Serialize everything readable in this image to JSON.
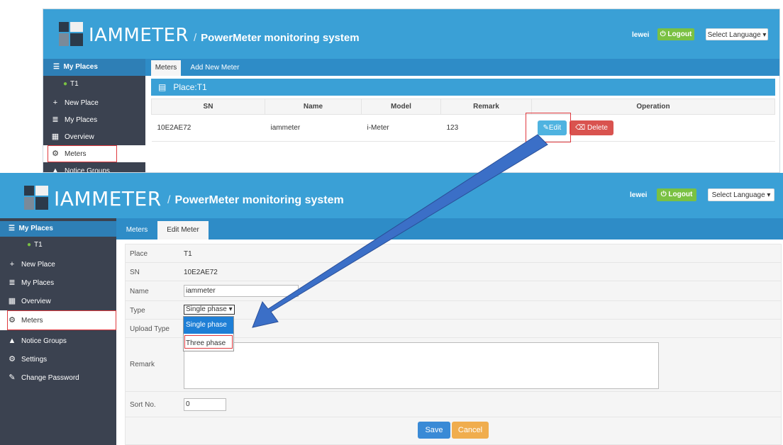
{
  "top_screen": {
    "brand": "IAMMETER",
    "subtitle": "PowerMeter monitoring system",
    "username": "lewei",
    "logout_label": "⏻ Logout",
    "language_label": "Select Language ▾",
    "sidebar": {
      "header": "My Places",
      "place": "T1",
      "items": [
        {
          "icon": "+",
          "label": "New Place"
        },
        {
          "icon": "≣",
          "label": "My Places"
        },
        {
          "icon": "▦",
          "label": "Overview"
        },
        {
          "icon": "⚙",
          "label": "Meters"
        },
        {
          "icon": "▲",
          "label": "Notice Groups"
        }
      ]
    },
    "tabs": [
      "Meters",
      "Add New Meter"
    ],
    "place_title": "Place:T1",
    "table": {
      "headers": [
        "SN",
        "Name",
        "Model",
        "Remark",
        "Operation"
      ],
      "rows": [
        {
          "sn": "10E2AE72",
          "name": "iammeter",
          "model": "i-Meter",
          "remark": "123",
          "edit": "✎Edit",
          "delete": "⌫ Delete"
        }
      ]
    }
  },
  "bottom_screen": {
    "brand": "IAMMETER",
    "subtitle": "PowerMeter monitoring system",
    "username": "lewei",
    "logout_label": "⏻ Logout",
    "language_label": "Select Language ▾",
    "sidebar": {
      "header": "My Places",
      "place": "T1",
      "items": [
        {
          "icon": "+",
          "label": "New Place"
        },
        {
          "icon": "≣",
          "label": "My Places"
        },
        {
          "icon": "▦",
          "label": "Overview"
        },
        {
          "icon": "⚙",
          "label": "Meters"
        },
        {
          "icon": "▲",
          "label": "Notice Groups"
        },
        {
          "icon": "⚙",
          "label": "Settings"
        },
        {
          "icon": "✎",
          "label": "Change Password"
        }
      ]
    },
    "tabs": [
      "Meters",
      "Edit Meter"
    ],
    "form": {
      "place_label": "Place",
      "place_value": "T1",
      "sn_label": "SN",
      "sn_value": "10E2AE72",
      "name_label": "Name",
      "name_value": "iammeter",
      "type_label": "Type",
      "type_value": "Single phase ▾",
      "upload_label": "Upload Type",
      "remark_label": "Remark",
      "remark_value": "",
      "sort_label": "Sort No.",
      "sort_value": "0",
      "type_options": [
        "Single phase",
        "Three phase"
      ],
      "save_label": "Save",
      "cancel_label": "Cancel"
    }
  },
  "colors": {
    "banner": "#3aa0d6",
    "sidebar": "#3b4250",
    "tabbar": "#2e8cc7",
    "logout": "#7ac143",
    "edit": "#4fb3e0",
    "delete": "#d9534f",
    "arrow": "#3b6fc7",
    "highlight": "#e0393e"
  }
}
